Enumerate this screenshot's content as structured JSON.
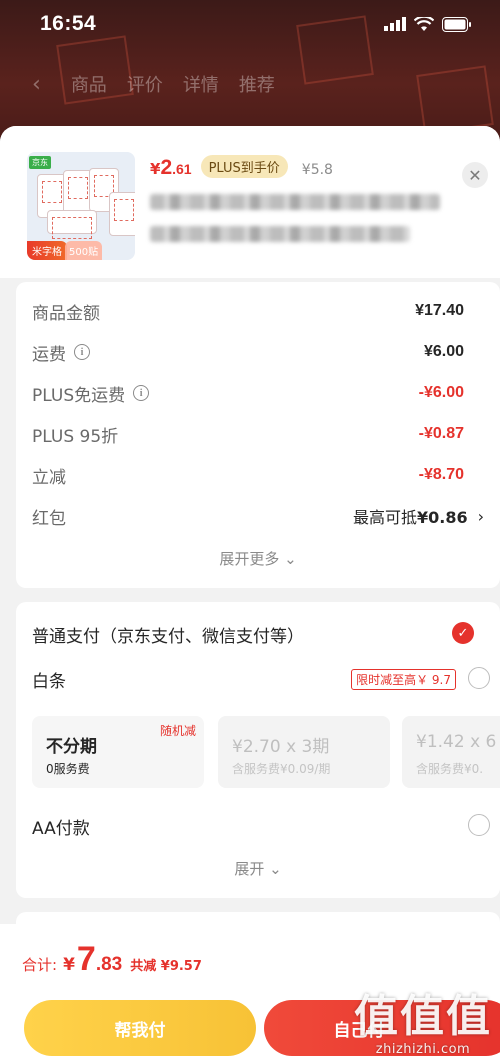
{
  "status_bar": {
    "time": "16:54"
  },
  "bg_nav": {
    "tabs": [
      "商品",
      "评价",
      "详情",
      "推荐"
    ]
  },
  "product": {
    "price_yen": "¥",
    "price_int": "2",
    "price_dec": ".61",
    "plus_tag": "PLUS到手价",
    "old_price": "¥5.8",
    "image_tag_left": "米字格",
    "image_tag_right": "500贴",
    "image_badge": "京东"
  },
  "fees": {
    "rows": [
      {
        "label": "商品金额",
        "value": "¥17.40",
        "info": false,
        "red": false
      },
      {
        "label": "运费",
        "value": "¥6.00",
        "info": true,
        "red": false
      },
      {
        "label": "PLUS免运费",
        "value": "-¥6.00",
        "info": true,
        "red": true
      },
      {
        "label": "PLUS 95折",
        "value": "-¥0.87",
        "info": false,
        "red": true
      },
      {
        "label": "立减",
        "value": "-¥8.70",
        "info": false,
        "red": true
      }
    ],
    "hongbao": {
      "label": "红包",
      "prefix": "最高可抵",
      "value": "¥0.86"
    },
    "expand_more": "展开更多"
  },
  "payment": {
    "normal": "普通支付（京东支付、微信支付等）",
    "baitiao": "白条",
    "limit_tag": "限时减至高￥ 9.7",
    "installments": [
      {
        "title": "不分期",
        "sub": "0服务费",
        "tag": "随机减"
      },
      {
        "title": "¥2.70 x 3期",
        "sub": "含服务费¥0.09/期",
        "tag": ""
      },
      {
        "title": "¥1.42 x 6",
        "sub": "含服务费¥0.",
        "tag": ""
      }
    ],
    "aa": "AA付款",
    "expand": "展开"
  },
  "bottom": {
    "total_label": "合计:",
    "total_yen": "¥",
    "total_int": "7",
    "total_dec": ".83",
    "saving": "共减 ¥9.57",
    "help_pay": "帮我付",
    "pay_self": "自己付"
  },
  "watermark": {
    "logo": "值值值",
    "url": "zhizhizhi.com"
  },
  "colors": {
    "accent_red": "#e5322c",
    "help_yellow": "#f7c236",
    "plus_gold": "#f7e7b8"
  }
}
